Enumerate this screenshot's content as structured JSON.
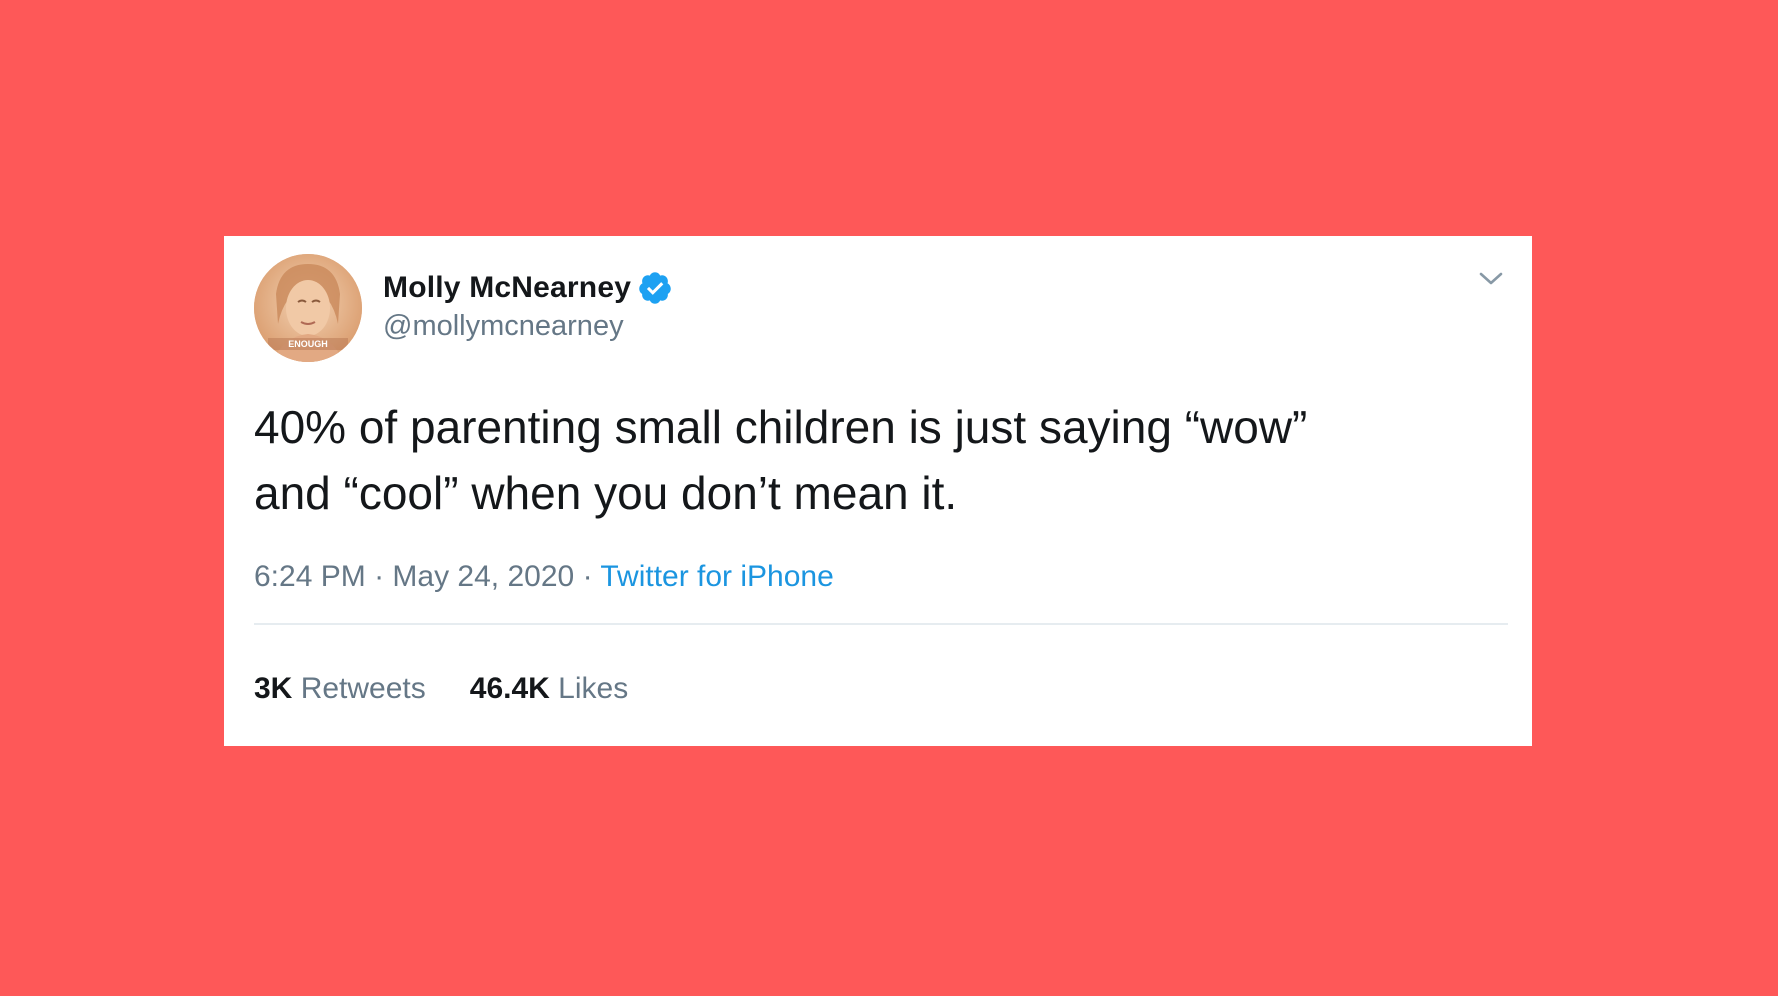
{
  "background_color": "#fe5858",
  "tweet": {
    "author": {
      "display_name": "Molly McNearney",
      "handle": "@mollymcnearney",
      "verified": true,
      "verified_icon": "verified-badge-icon",
      "avatar_text": "ENOUGH"
    },
    "text_line1": "40% of parenting small children is just saying “wow”",
    "text_line2": "and “cool” when you don’t mean it.",
    "time": "6:24 PM",
    "separator": "·",
    "date": "May 24, 2020",
    "source": "Twitter for iPhone",
    "stats": {
      "retweets_count": "3K",
      "retweets_label": "Retweets",
      "likes_count": "46.4K",
      "likes_label": "Likes"
    },
    "menu_icon": "chevron-down-icon"
  },
  "colors": {
    "link": "#1b95e0",
    "secondary_text": "#657786",
    "primary_text": "#14171a",
    "verified": "#1da1f2"
  }
}
